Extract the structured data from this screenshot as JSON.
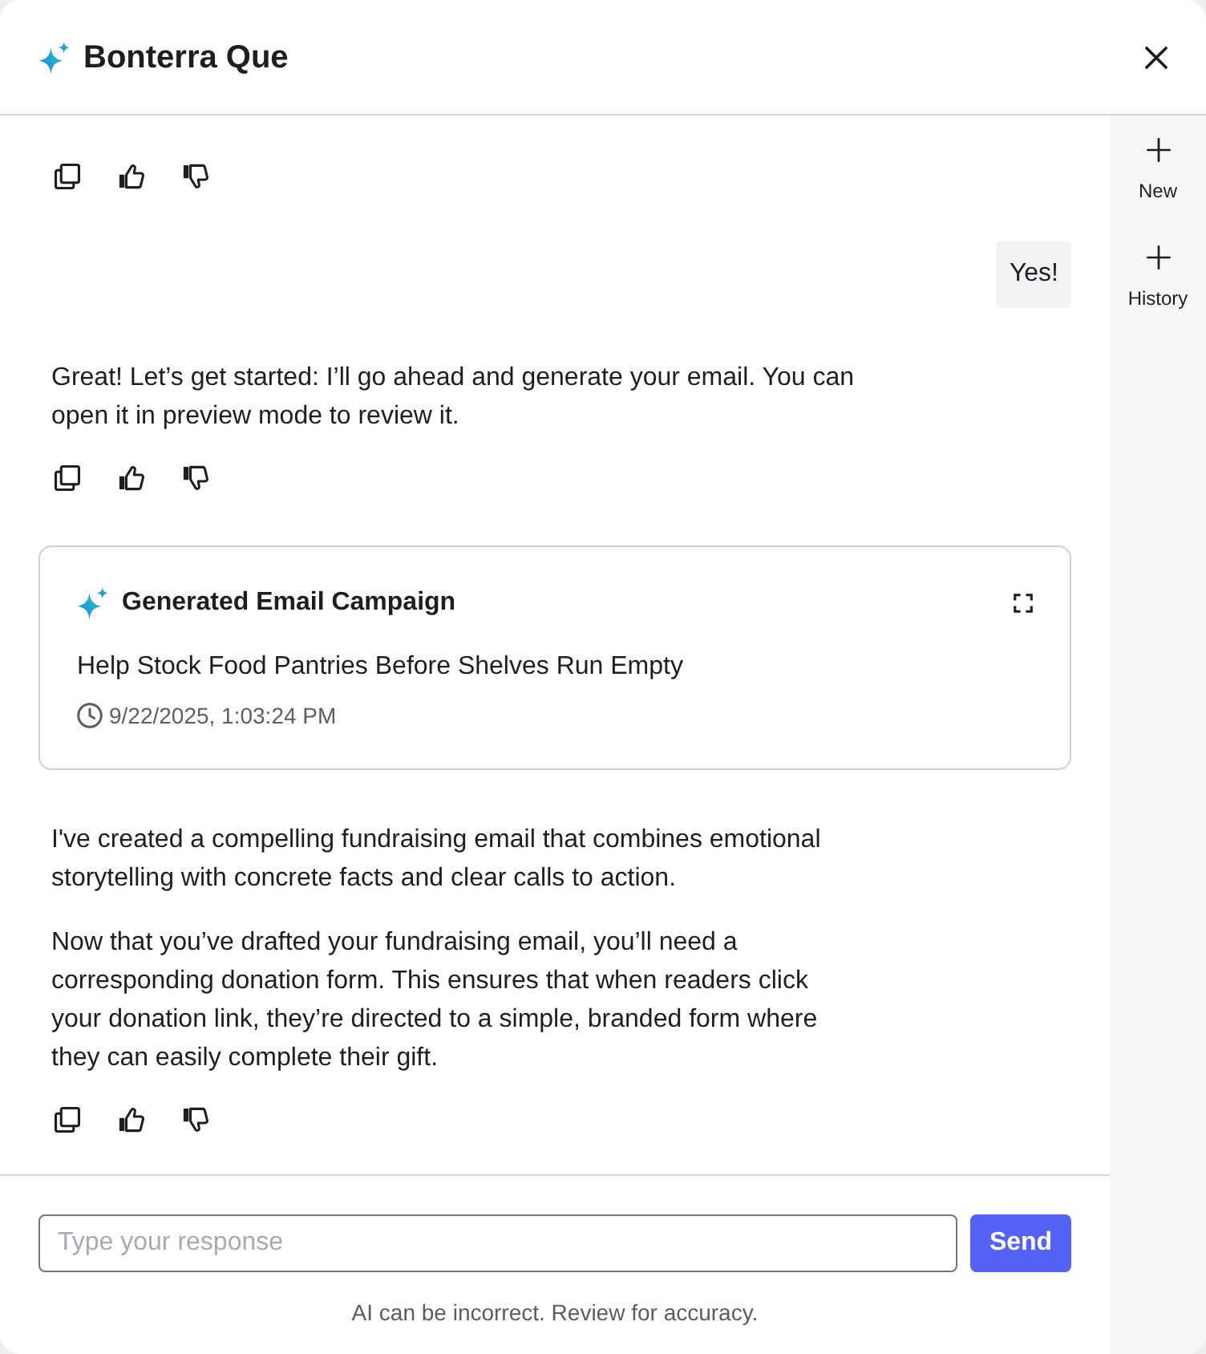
{
  "header": {
    "title": "Bonterra Que"
  },
  "messages": [
    {
      "kind": "assistant"
    },
    {
      "kind": "user",
      "text": "Yes!"
    },
    {
      "kind": "assistant",
      "paragraphs": [
        "Great! Let’s get started: I’ll go ahead and generate your email. You can open it in preview mode to review it."
      ]
    },
    {
      "kind": "artifact",
      "title": "Generated Email Campaign",
      "subject": "Help Stock Food Pantries Before Shelves Run Empty",
      "timestamp": "9/22/2025, 1:03:24 PM"
    },
    {
      "kind": "assistant",
      "paragraphs": [
        "I've created a compelling fundraising email that combines emotional storytelling with concrete facts and clear calls to action.",
        "Now that you’ve drafted your fundraising email, you’ll need a corresponding donation form. This ensures that when readers click your donation link, they’re directed to a simple, branded form where they can easily complete their gift."
      ]
    }
  ],
  "sidebar": {
    "items": [
      {
        "label": "New"
      },
      {
        "label": "History"
      }
    ]
  },
  "composer": {
    "placeholder": "Type your response",
    "send": "Send",
    "disclaimer": "AI can be incorrect. Review for accuracy."
  }
}
